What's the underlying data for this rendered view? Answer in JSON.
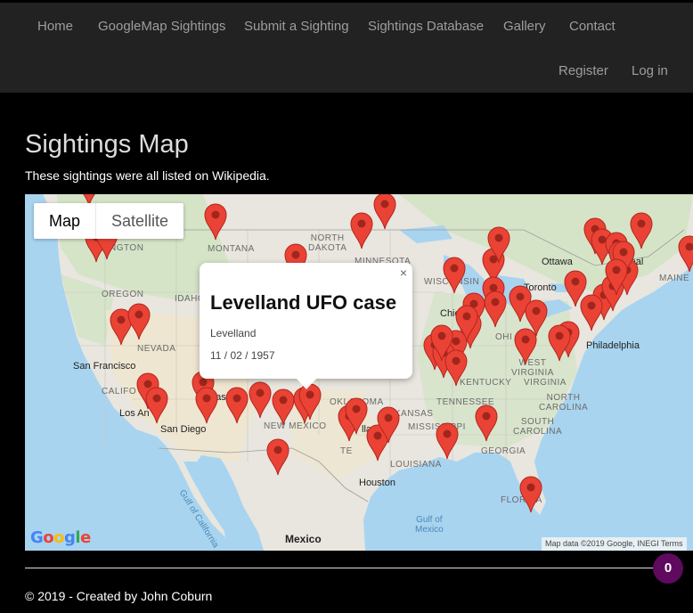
{
  "nav": {
    "items": [
      "Home",
      "GoogleMap Sightings",
      "Submit a Sighting",
      "Sightings Database",
      "Gallery",
      "Contact"
    ],
    "register": "Register",
    "login": "Log in"
  },
  "page": {
    "title": "Sightings Map",
    "subtitle": "These sightings were all listed on Wikipedia."
  },
  "map": {
    "type_map": "Map",
    "type_satellite": "Satellite",
    "labels": {
      "montana": "MONTANA",
      "north_dakota": "NORTH\nDAKOTA",
      "minnesota": "MINNESOTA",
      "oregon": "OREGON",
      "idaho": "IDAHO",
      "nevada": "NEVADA",
      "california": "CALIFO",
      "wisconsin": "WISCONSIN",
      "ohio": "OHI",
      "west_virginia": "WEST\nVIRGINIA",
      "virginia": "VIRGINIA",
      "kentucky": "KENTUCKY",
      "tennessee": "TENNESSEE",
      "north_carolina": "NORTH\nCAROLINA",
      "south_carolina": "SOUTH\nCAROLINA",
      "georgia": "GEORGIA",
      "arkansas": "ARKANSAS",
      "mississippi": "MISSISSIPPI",
      "louisiana": "LOUISIANA",
      "oklahoma": "OKLAHOMA",
      "new_mexico": "NEW MEXICO",
      "florida": "FLORIDA",
      "maine": "MAINE",
      "washington": "HINGTON",
      "te": "TE",
      "ottawa": "Ottawa",
      "toronto": "Toronto",
      "montreal": "real",
      "chicago": "Chica",
      "philadelphia": "Philadelphia",
      "san_francisco": "San Francisco",
      "las_vegas": "Las",
      "los_angeles": "Los An",
      "san_diego": "San Diego",
      "dallas": "llas",
      "houston": "Houston",
      "gulf_of_california": "Gulf of California",
      "gulf_of_mexico": "Gulf of\nMexico",
      "mexico": "Mexico"
    },
    "info_window": {
      "title": "Levelland UFO case",
      "place": "Levelland",
      "date": "11 / 02 / 1957",
      "close": "×"
    },
    "google_logo": "Google",
    "attribution": "Map data ©2019 Google, INEGI   Terms",
    "pin_count": 64
  },
  "colors": {
    "pin": "#ea4335",
    "pin_dot": "#a0261c",
    "navbar": "#222222",
    "badge": "#5e0a5e"
  },
  "badge": "0",
  "footer": "© 2019 - Created by John Coburn"
}
